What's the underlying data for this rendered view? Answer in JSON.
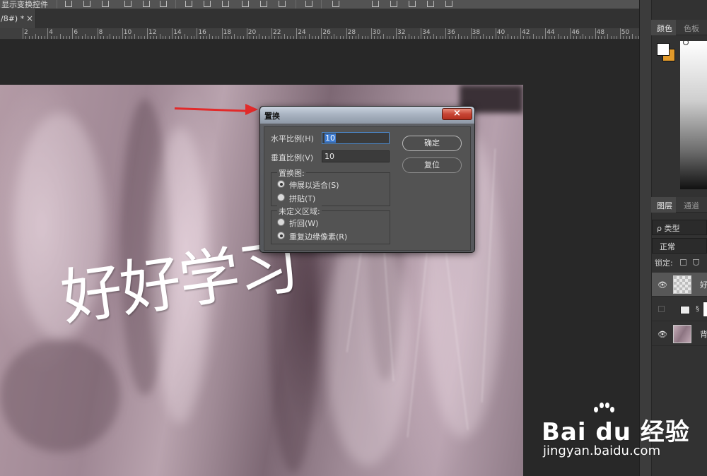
{
  "app": {
    "options_bar_text": "显示变换控件",
    "document_tab": {
      "title": "/8#) *",
      "close": "×"
    }
  },
  "ruler": {
    "labels": [
      "2",
      "4",
      "6",
      "8",
      "10",
      "12",
      "14",
      "16",
      "18",
      "20",
      "22",
      "24",
      "26",
      "28",
      "30",
      "32",
      "34",
      "36",
      "38",
      "40",
      "42",
      "44",
      "46",
      "48",
      "50"
    ]
  },
  "canvas": {
    "art_text": "好好学习"
  },
  "dialog": {
    "title": "置换",
    "close": "×",
    "horizontal_scale": {
      "label": "水平比例(H)",
      "value": "10"
    },
    "vertical_scale": {
      "label": "垂直比例(V)",
      "value": "10"
    },
    "ok_label": "确定",
    "reset_label": "复位",
    "displacement_map": {
      "label": "置换图:",
      "options": [
        {
          "label": "伸展以适合(S)",
          "selected": true
        },
        {
          "label": "拼贴(T)",
          "selected": false
        }
      ]
    },
    "undefined_areas": {
      "label": "未定义区域:",
      "options": [
        {
          "label": "折回(W)",
          "selected": false
        },
        {
          "label": "重复边缘像素(R)",
          "selected": true
        }
      ]
    }
  },
  "right_panel": {
    "color_tabs": [
      "颜色",
      "色板"
    ],
    "layer_tabs": [
      "图层",
      "通道"
    ],
    "kind_filter": "ρ 类型",
    "blend_mode": "正常",
    "lock_label": "锁定:",
    "layers": [
      {
        "name": "好",
        "visible": true,
        "selected": true,
        "thumb": "text"
      },
      {
        "name": "",
        "visible": false,
        "selected": false,
        "thumb": "adjustment"
      },
      {
        "name": "背",
        "visible": true,
        "selected": false,
        "thumb": "photo"
      }
    ],
    "foreground_color": "#ffffff",
    "background_color": "#e29a2a"
  },
  "watermark": {
    "logo": "Bai du 经验",
    "url": "jingyan.baidu.com"
  }
}
